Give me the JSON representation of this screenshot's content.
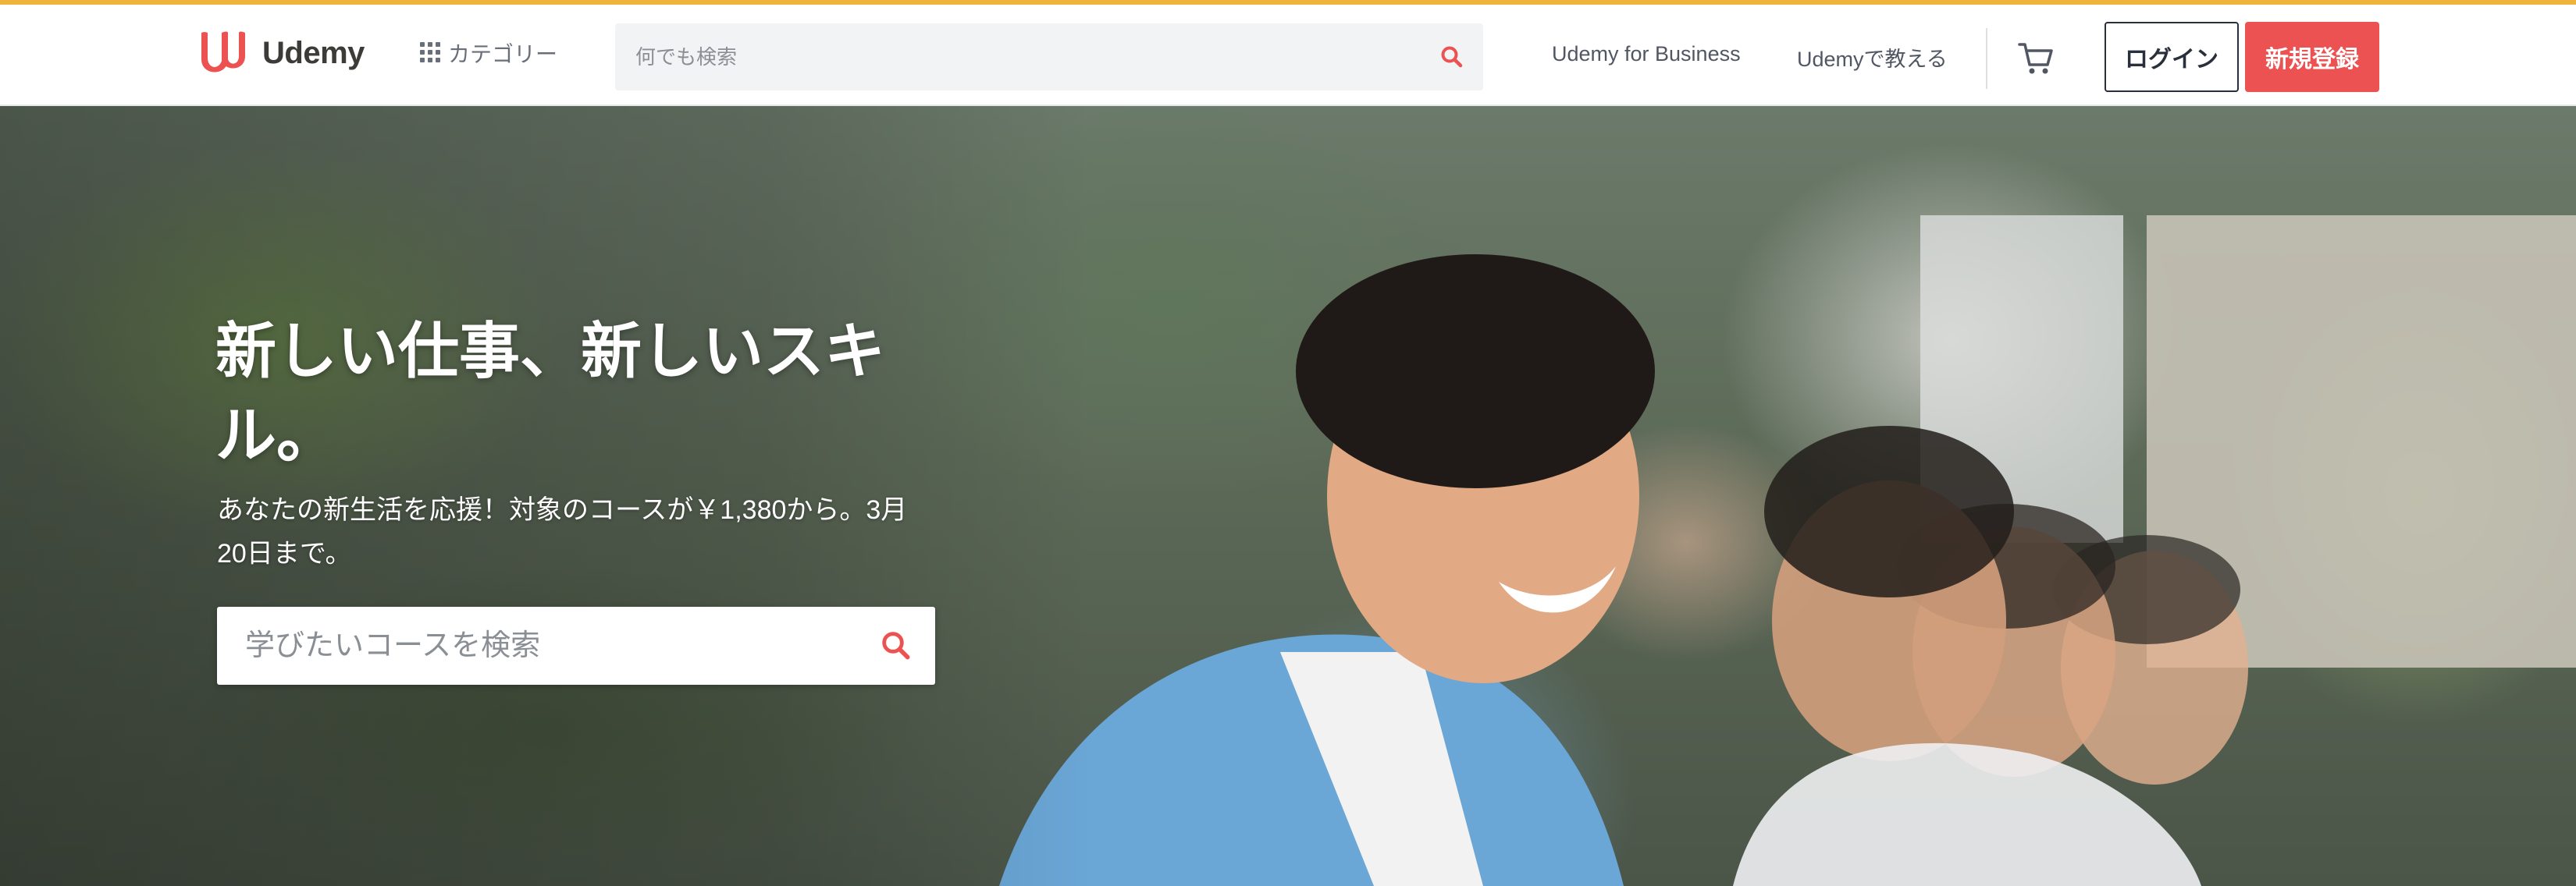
{
  "brand": {
    "name": "Udemy",
    "accent_color": "#ec5252",
    "stripe_color": "#f0b43c"
  },
  "header": {
    "categories_label": "カテゴリー",
    "search_placeholder": "何でも検索",
    "business_link": "Udemy for Business",
    "teach_link": "Udemyで教える",
    "login_label": "ログイン",
    "signup_label": "新規登録"
  },
  "hero": {
    "title": "新しい仕事、新しいスキル。",
    "subtitle": "あなたの新生活を応援！対象のコースが￥1,380から。3月20日まで。",
    "search_placeholder": "学びたいコースを検索"
  },
  "icons": {
    "logo": "udemy-logo-icon",
    "categories": "grid-icon",
    "search": "search-icon",
    "cart": "cart-icon"
  }
}
